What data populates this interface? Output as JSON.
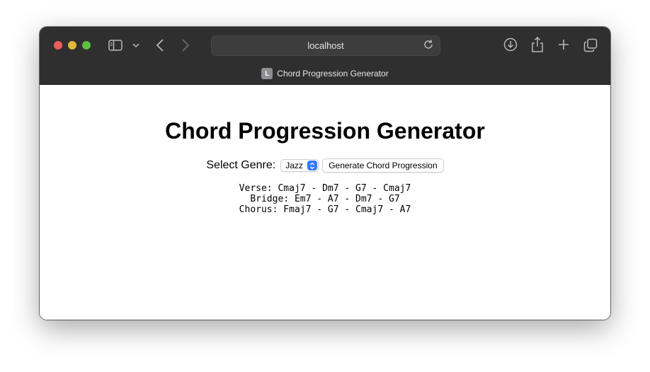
{
  "browser": {
    "url": "localhost",
    "tab_title": "Chord Progression Generator",
    "favicon_letter": "L"
  },
  "page": {
    "heading": "Chord Progression Generator",
    "genre_label": "Select Genre:",
    "genre_selected": "Jazz",
    "generate_label": "Generate Chord Progression",
    "progressions": [
      "Verse: Cmaj7 - Dm7 - G7 - Cmaj7",
      "Bridge: Em7 - A7 - Dm7 - G7",
      "Chorus: Fmaj7 - G7 - Cmaj7 - A7"
    ]
  },
  "icons": {
    "sidebar": "sidebar-icon",
    "chevron": "chevron-down-icon",
    "back": "back-arrow-icon",
    "forward": "forward-arrow-icon",
    "reload": "reload-icon",
    "download": "download-icon",
    "share": "share-icon",
    "new_tab": "plus-icon",
    "tabs_overview": "tabs-overview-icon"
  },
  "colors": {
    "titlebar": "#2f2f2f",
    "select_accent": "#3478f6",
    "close": "#ec5f57",
    "minimize": "#e0b83a",
    "maximize": "#5fc13f"
  }
}
